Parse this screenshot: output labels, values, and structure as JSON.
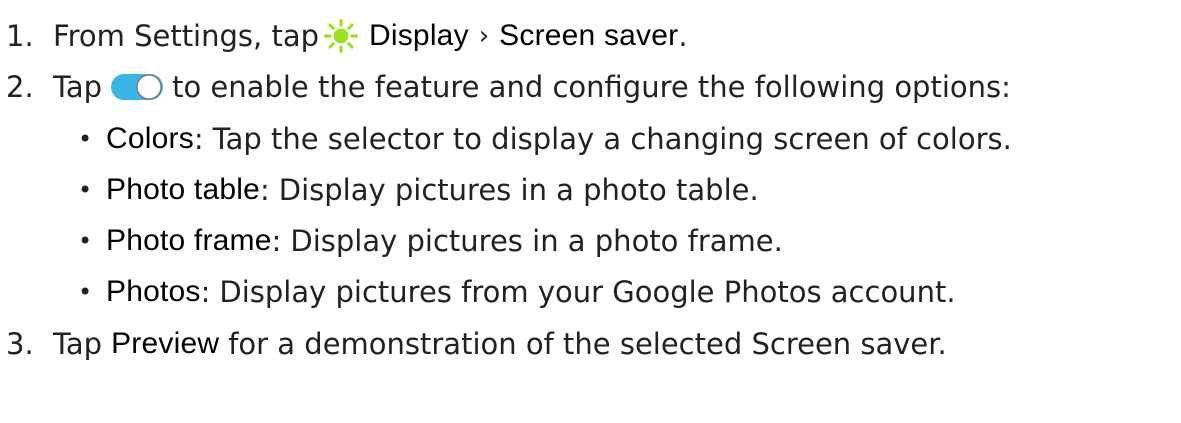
{
  "colors": {
    "sun_icon": "#9be21f",
    "toggle_track": "#3bb4e8",
    "toggle_knob": "#ffffff",
    "toggle_border": "#777777"
  },
  "steps": [
    {
      "number": "1.",
      "prefix": "From Settings, tap",
      "icon": "sun-icon",
      "item1": "Display",
      "separator": "›",
      "item2": "Screen saver",
      "suffix": "."
    },
    {
      "number": "2.",
      "prefix": "Tap",
      "icon": "toggle-switch-icon",
      "suffix": "to enable the feature and configure the following options:"
    },
    {
      "number": "3.",
      "prefix": "Tap",
      "ui": "Preview",
      "suffix": "for a demonstration of the selected Screen saver."
    }
  ],
  "options": [
    {
      "bullet": "•",
      "label": "Colors",
      "colon": ":",
      "text": "Tap the selector to display a changing screen of colors."
    },
    {
      "bullet": "•",
      "label": "Photo table",
      "colon": ":",
      "text": "Display pictures in a photo table."
    },
    {
      "bullet": "•",
      "label": "Photo frame",
      "colon": ":",
      "text": "Display pictures in a photo frame."
    },
    {
      "bullet": "•",
      "label": "Photos",
      "colon": ":",
      "text": "Display pictures from your Google Photos account."
    }
  ]
}
